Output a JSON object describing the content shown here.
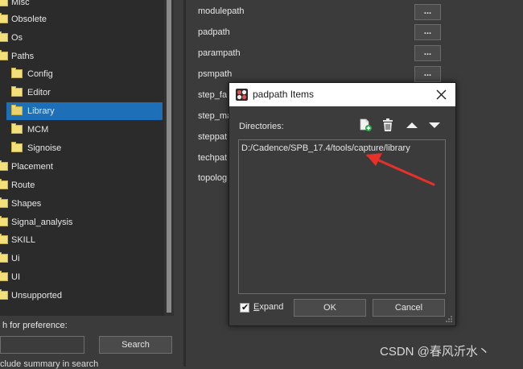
{
  "tree": {
    "items": [
      {
        "label": "Misc",
        "level": 0
      },
      {
        "label": "Obsolete",
        "level": 0
      },
      {
        "label": "Os",
        "level": 0
      },
      {
        "label": "Paths",
        "level": 0
      },
      {
        "label": "Config",
        "level": 1
      },
      {
        "label": "Editor",
        "level": 1
      },
      {
        "label": "Library",
        "level": 1,
        "selected": true
      },
      {
        "label": "MCM",
        "level": 1
      },
      {
        "label": "Signoise",
        "level": 1
      },
      {
        "label": "Placement",
        "level": 0
      },
      {
        "label": "Route",
        "level": 0
      },
      {
        "label": "Shapes",
        "level": 0
      },
      {
        "label": "Signal_analysis",
        "level": 0
      },
      {
        "label": "SKILL",
        "level": 0
      },
      {
        "label": "Ui",
        "level": 0
      },
      {
        "label": "UI",
        "level": 0
      },
      {
        "label": "Unsupported",
        "level": 0
      }
    ]
  },
  "search": {
    "label": "h for preference:",
    "input_value": "",
    "button": "Search",
    "include_summary": "clude summary in search"
  },
  "properties": [
    {
      "label": "modulepath",
      "button": "..."
    },
    {
      "label": "padpath",
      "button": "..."
    },
    {
      "label": "parampath",
      "button": "..."
    },
    {
      "label": "psmpath",
      "button": "..."
    },
    {
      "label": "step_fa",
      "button": ""
    },
    {
      "label": "step_ma",
      "button": ""
    },
    {
      "label": "steppat",
      "button": ""
    },
    {
      "label": "techpat",
      "button": ""
    },
    {
      "label": "topolog",
      "button": ""
    }
  ],
  "dialog": {
    "title": "padpath Items",
    "directories_label": "Directories:",
    "entries": [
      "D:/Cadence/SPB_17.4/tools/capture/library"
    ],
    "expand_label": "Expand",
    "expand_checked": true,
    "ok": "OK",
    "cancel": "Cancel",
    "icons": [
      "new-folder-icon",
      "trash-icon",
      "move-up-icon",
      "move-down-icon"
    ],
    "arrow_color": "#e8302a"
  },
  "watermark": "CSDN @春风沂水丶"
}
